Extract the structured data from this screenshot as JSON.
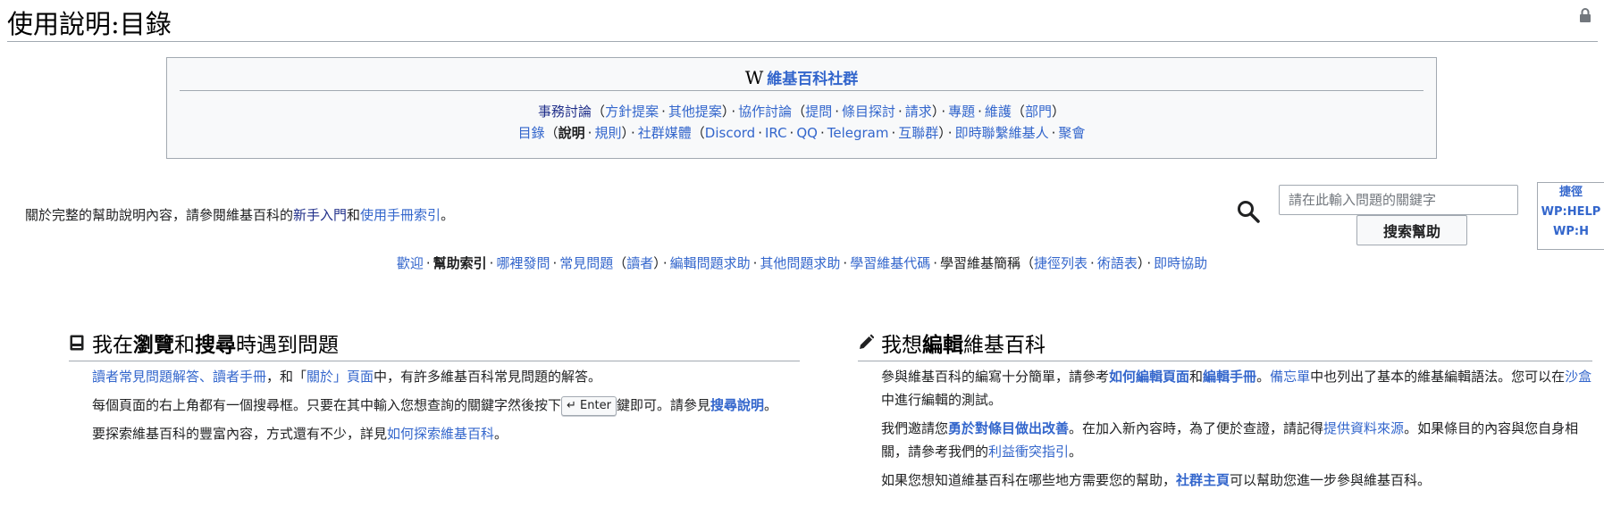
{
  "title": "使用說明:目錄",
  "community": {
    "logo": "W",
    "header": "維基百科社群",
    "row1": [
      {
        "text": "事務討論",
        "kind": "dark"
      },
      {
        "text": "（",
        "kind": "paren"
      },
      {
        "text": "方針提案",
        "kind": "link"
      },
      {
        "text": "·",
        "kind": "sep"
      },
      {
        "text": "其他提案",
        "kind": "link"
      },
      {
        "text": "）",
        "kind": "paren"
      },
      {
        "text": "·",
        "kind": "sep"
      },
      {
        "text": "協作討論",
        "kind": "link"
      },
      {
        "text": "（",
        "kind": "paren"
      },
      {
        "text": "提問",
        "kind": "link"
      },
      {
        "text": "·",
        "kind": "sep"
      },
      {
        "text": "條目探討",
        "kind": "link"
      },
      {
        "text": "·",
        "kind": "sep"
      },
      {
        "text": "請求",
        "kind": "link"
      },
      {
        "text": "）",
        "kind": "paren"
      },
      {
        "text": "·",
        "kind": "sep"
      },
      {
        "text": "專題",
        "kind": "link"
      },
      {
        "text": "·",
        "kind": "sep"
      },
      {
        "text": "維護",
        "kind": "link"
      },
      {
        "text": "（",
        "kind": "paren"
      },
      {
        "text": "部門",
        "kind": "link"
      },
      {
        "text": "）",
        "kind": "paren"
      }
    ],
    "row2": [
      {
        "text": "目錄",
        "kind": "link"
      },
      {
        "text": "（",
        "kind": "paren"
      },
      {
        "text": "說明",
        "kind": "bold"
      },
      {
        "text": "·",
        "kind": "sep"
      },
      {
        "text": "規則",
        "kind": "link"
      },
      {
        "text": "）",
        "kind": "paren"
      },
      {
        "text": "·",
        "kind": "sep"
      },
      {
        "text": "社群媒體",
        "kind": "link"
      },
      {
        "text": "（",
        "kind": "paren"
      },
      {
        "text": "Discord",
        "kind": "link"
      },
      {
        "text": "·",
        "kind": "sep"
      },
      {
        "text": "IRC",
        "kind": "link"
      },
      {
        "text": "·",
        "kind": "sep"
      },
      {
        "text": "QQ",
        "kind": "link"
      },
      {
        "text": "·",
        "kind": "sep"
      },
      {
        "text": "Telegram",
        "kind": "link"
      },
      {
        "text": "·",
        "kind": "sep"
      },
      {
        "text": "互聯群",
        "kind": "link"
      },
      {
        "text": "）",
        "kind": "paren"
      },
      {
        "text": "·",
        "kind": "sep"
      },
      {
        "text": "即時聯繫維基人",
        "kind": "link"
      },
      {
        "text": "·",
        "kind": "sep"
      },
      {
        "text": "聚會",
        "kind": "link"
      }
    ]
  },
  "intro": {
    "prefix": "關於完整的幫助說明內容，請參閱維基百科的",
    "link1": "新手入門",
    "mid": "和",
    "link2": "使用手冊索引",
    "suffix": "。"
  },
  "search": {
    "placeholder": "請在此輸入問題的關鍵字",
    "button": "搜索幫助"
  },
  "shortcut": {
    "label": "捷徑",
    "items": [
      "WP:HELP",
      "WP:H"
    ]
  },
  "nav": [
    {
      "text": "歡迎",
      "kind": "link"
    },
    {
      "text": "·",
      "kind": "sep"
    },
    {
      "text": "幫助索引",
      "kind": "bold"
    },
    {
      "text": "·",
      "kind": "sep"
    },
    {
      "text": "哪裡發問",
      "kind": "link"
    },
    {
      "text": "·",
      "kind": "sep"
    },
    {
      "text": "常見問題",
      "kind": "link"
    },
    {
      "text": "（",
      "kind": "paren"
    },
    {
      "text": "讀者",
      "kind": "link"
    },
    {
      "text": "）",
      "kind": "paren"
    },
    {
      "text": "·",
      "kind": "sep"
    },
    {
      "text": "編輯問題求助",
      "kind": "link"
    },
    {
      "text": "·",
      "kind": "sep"
    },
    {
      "text": "其他問題求助",
      "kind": "link"
    },
    {
      "text": "·",
      "kind": "sep"
    },
    {
      "text": "學習維基代碼",
      "kind": "link"
    },
    {
      "text": "·",
      "kind": "sep"
    },
    {
      "text": "學習維基簡稱",
      "kind": "plain"
    },
    {
      "text": "（",
      "kind": "paren"
    },
    {
      "text": "捷徑列表",
      "kind": "link"
    },
    {
      "text": "·",
      "kind": "sep"
    },
    {
      "text": "術語表",
      "kind": "link"
    },
    {
      "text": "）",
      "kind": "paren"
    },
    {
      "text": "·",
      "kind": "sep"
    },
    {
      "text": "即時協助",
      "kind": "link"
    }
  ],
  "left_section": {
    "heading": [
      {
        "text": "我在",
        "kind": "plain"
      },
      {
        "text": "瀏覽",
        "kind": "bold"
      },
      {
        "text": "和",
        "kind": "plain"
      },
      {
        "text": "搜尋",
        "kind": "bold"
      },
      {
        "text": "時遇到問題",
        "kind": "plain"
      }
    ],
    "paragraphs": [
      [
        {
          "text": "讀者常見問題解答、讀者手冊",
          "kind": "link"
        },
        {
          "text": "，和「",
          "kind": "plain"
        },
        {
          "text": "關於」頁面",
          "kind": "link"
        },
        {
          "text": "中，有許多維基百科常見問題的解答。",
          "kind": "plain"
        }
      ],
      [
        {
          "text": "每個頁面的右上角都有一個搜尋框。只要在其中輸入您想查詢的關鍵字然後按下",
          "kind": "plain"
        },
        {
          "text": "↵ Enter",
          "kind": "kbd"
        },
        {
          "text": "鍵即可。請參見",
          "kind": "plain"
        },
        {
          "text": "搜尋說明",
          "kind": "boldlink"
        },
        {
          "text": "。",
          "kind": "plain"
        }
      ],
      [
        {
          "text": "要探索維基百科的豐富內容，方式還有不少，詳見",
          "kind": "plain"
        },
        {
          "text": "如何探索維基百科",
          "kind": "link"
        },
        {
          "text": "。",
          "kind": "plain"
        }
      ]
    ]
  },
  "right_section": {
    "heading": [
      {
        "text": "我想",
        "kind": "plain"
      },
      {
        "text": "編輯",
        "kind": "bold"
      },
      {
        "text": "維基百科",
        "kind": "plain"
      }
    ],
    "paragraphs": [
      [
        {
          "text": "參與維基百科的編寫十分簡單，請參考",
          "kind": "plain"
        },
        {
          "text": "如何編輯頁面",
          "kind": "boldlink"
        },
        {
          "text": "和",
          "kind": "plain"
        },
        {
          "text": "編輯手冊",
          "kind": "boldlink"
        },
        {
          "text": "。",
          "kind": "plain"
        },
        {
          "text": "備忘單",
          "kind": "link"
        },
        {
          "text": "中也列出了基本的維基編輯語法。您可以在",
          "kind": "plain"
        },
        {
          "text": "沙盒",
          "kind": "link"
        },
        {
          "text": "中進行編輯的測試。",
          "kind": "plain"
        }
      ],
      [
        {
          "text": "我們邀請您",
          "kind": "plain"
        },
        {
          "text": "勇於對條目做出改善",
          "kind": "boldlink"
        },
        {
          "text": "。在加入新內容時，為了便於查證，請記得",
          "kind": "plain"
        },
        {
          "text": "提供資料來源",
          "kind": "link"
        },
        {
          "text": "。如果條目的內容與您自身相關，請參考我們的",
          "kind": "plain"
        },
        {
          "text": "利益衝突指引",
          "kind": "link"
        },
        {
          "text": "。",
          "kind": "plain"
        }
      ],
      [
        {
          "text": "如果您想知道維基百科在哪些地方需要您的幫助，",
          "kind": "plain"
        },
        {
          "text": "社群主頁",
          "kind": "boldlink"
        },
        {
          "text": "可以幫助您進一步參與維基百科。",
          "kind": "plain"
        }
      ]
    ]
  }
}
